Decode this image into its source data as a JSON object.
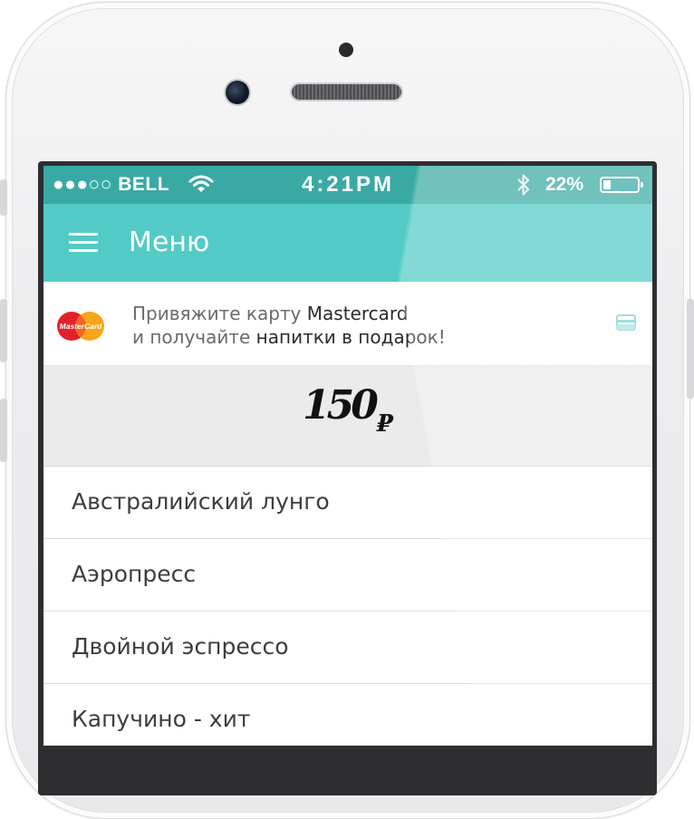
{
  "status_bar": {
    "carrier": "●●●○○ BELL",
    "time": "4:21PM",
    "battery_percent": "22%",
    "battery_level": 0.22,
    "icons": [
      "wifi-icon",
      "bluetooth-icon",
      "battery-icon"
    ]
  },
  "app_bar": {
    "title": "Меню",
    "menu_icon": "hamburger-icon",
    "background_color": "#52cbc6"
  },
  "promo": {
    "line1_prefix": "Привяжите карту ",
    "line1_bold": "Mastercard",
    "line2_prefix": "и получайте ",
    "line2_bold": "напитки в подарок!",
    "logo_text": "MasterCard",
    "card_icon": "credit-card-icon"
  },
  "price_banner": {
    "amount": "150",
    "currency": "₽"
  },
  "menu_items": [
    {
      "label": "Австралийский лунго"
    },
    {
      "label": "Аэропресс"
    },
    {
      "label": "Двойной эспрессо"
    },
    {
      "label": "Капучино - хит"
    }
  ]
}
